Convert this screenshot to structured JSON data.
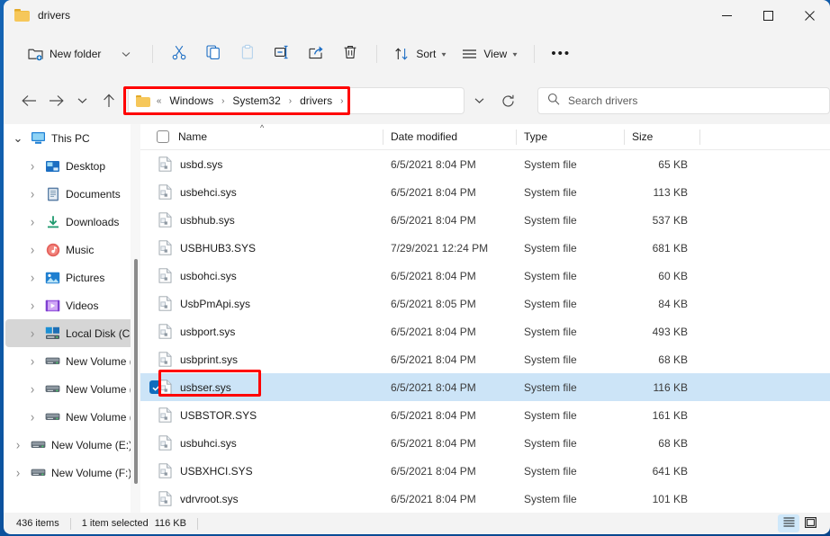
{
  "window": {
    "title": "drivers",
    "folder_icon": "folder-icon",
    "controls": {
      "minimize": "minimize",
      "maximize": "maximize",
      "close": "close"
    }
  },
  "toolbar": {
    "new_folder_label": "New folder",
    "new_folder_icon": "new-folder-icon",
    "new_folder_dropdown": "chevron-down-icon",
    "cut_icon": "cut-icon",
    "copy_icon": "copy-icon",
    "paste_icon": "paste-icon",
    "rename_icon": "rename-icon",
    "share_icon": "share-icon",
    "delete_icon": "delete-icon",
    "sort_label": "Sort",
    "sort_icon": "sort-icon",
    "view_label": "View",
    "view_icon": "view-icon",
    "more_label": "•••",
    "more_icon": "more-options-icon"
  },
  "navigation": {
    "back_icon": "back-arrow-icon",
    "forward_icon": "forward-arrow-icon",
    "recent_icon": "chevron-down-icon",
    "up_icon": "up-arrow-icon",
    "refresh_icon": "refresh-icon",
    "breadcrumb": {
      "folder_icon": "folder-icon",
      "overflow": "«",
      "segments": [
        "Windows",
        "System32",
        "drivers"
      ],
      "separator": "›",
      "trailing_separator": "›",
      "dropdown_icon": "chevron-down-icon"
    }
  },
  "search": {
    "placeholder": "Search drivers",
    "icon": "search-icon"
  },
  "sidebar": {
    "items": [
      {
        "label": "This PC",
        "icon": "this-pc-icon",
        "level": 1,
        "expanded": true,
        "selected": false
      },
      {
        "label": "Desktop",
        "icon": "desktop-icon",
        "level": 2,
        "expanded": false,
        "selected": false
      },
      {
        "label": "Documents",
        "icon": "documents-icon",
        "level": 2,
        "expanded": false,
        "selected": false
      },
      {
        "label": "Downloads",
        "icon": "downloads-icon",
        "level": 2,
        "expanded": false,
        "selected": false
      },
      {
        "label": "Music",
        "icon": "music-icon",
        "level": 2,
        "expanded": false,
        "selected": false
      },
      {
        "label": "Pictures",
        "icon": "pictures-icon",
        "level": 2,
        "expanded": false,
        "selected": false
      },
      {
        "label": "Videos",
        "icon": "videos-icon",
        "level": 2,
        "expanded": false,
        "selected": false
      },
      {
        "label": "Local Disk (C:)",
        "icon": "local-disk-icon",
        "level": 2,
        "expanded": false,
        "selected": true
      },
      {
        "label": "New Volume (E",
        "icon": "drive-icon",
        "level": 2,
        "expanded": false,
        "selected": false
      },
      {
        "label": "New Volume (F",
        "icon": "drive-icon",
        "level": 2,
        "expanded": false,
        "selected": false
      },
      {
        "label": "New Volume (G",
        "icon": "drive-icon",
        "level": 2,
        "expanded": false,
        "selected": false
      },
      {
        "label": "New Volume (E:)",
        "icon": "drive-icon",
        "level": 1,
        "expanded": false,
        "selected": false
      },
      {
        "label": "New Volume (F:)",
        "icon": "drive-icon",
        "level": 1,
        "expanded": false,
        "selected": false
      }
    ]
  },
  "file_list": {
    "columns": [
      {
        "key": "name",
        "label": "Name"
      },
      {
        "key": "date",
        "label": "Date modified"
      },
      {
        "key": "type",
        "label": "Type"
      },
      {
        "key": "size",
        "label": "Size"
      }
    ],
    "sort_indicator": "^",
    "select_all_checkbox": "select-all-checkbox",
    "rows": [
      {
        "name": "usbd.sys",
        "date": "6/5/2021 8:04 PM",
        "type": "System file",
        "size": "65 KB",
        "selected": false
      },
      {
        "name": "usbehci.sys",
        "date": "6/5/2021 8:04 PM",
        "type": "System file",
        "size": "113 KB",
        "selected": false
      },
      {
        "name": "usbhub.sys",
        "date": "6/5/2021 8:04 PM",
        "type": "System file",
        "size": "537 KB",
        "selected": false
      },
      {
        "name": "USBHUB3.SYS",
        "date": "7/29/2021 12:24 PM",
        "type": "System file",
        "size": "681 KB",
        "selected": false
      },
      {
        "name": "usbohci.sys",
        "date": "6/5/2021 8:04 PM",
        "type": "System file",
        "size": "60 KB",
        "selected": false
      },
      {
        "name": "UsbPmApi.sys",
        "date": "6/5/2021 8:05 PM",
        "type": "System file",
        "size": "84 KB",
        "selected": false
      },
      {
        "name": "usbport.sys",
        "date": "6/5/2021 8:04 PM",
        "type": "System file",
        "size": "493 KB",
        "selected": false
      },
      {
        "name": "usbprint.sys",
        "date": "6/5/2021 8:04 PM",
        "type": "System file",
        "size": "68 KB",
        "selected": false
      },
      {
        "name": "usbser.sys",
        "date": "6/5/2021 8:04 PM",
        "type": "System file",
        "size": "116 KB",
        "selected": true
      },
      {
        "name": "USBSTOR.SYS",
        "date": "6/5/2021 8:04 PM",
        "type": "System file",
        "size": "161 KB",
        "selected": false
      },
      {
        "name": "usbuhci.sys",
        "date": "6/5/2021 8:04 PM",
        "type": "System file",
        "size": "68 KB",
        "selected": false
      },
      {
        "name": "USBXHCI.SYS",
        "date": "6/5/2021 8:04 PM",
        "type": "System file",
        "size": "641 KB",
        "selected": false
      },
      {
        "name": "vdrvroot.sys",
        "date": "6/5/2021 8:04 PM",
        "type": "System file",
        "size": "101 KB",
        "selected": false
      }
    ]
  },
  "status_bar": {
    "item_count": "436 items",
    "selection": "1 item selected",
    "selection_size": "116 KB",
    "details_view_icon": "details-view-icon",
    "large_icons_view_icon": "large-icons-view-icon"
  },
  "highlights": {
    "breadcrumb_box": "red",
    "selected_file_box": "red",
    "accent_color": "#0f6cbd",
    "selection_color": "#cce4f7",
    "highlight_color": "#ff0000"
  }
}
